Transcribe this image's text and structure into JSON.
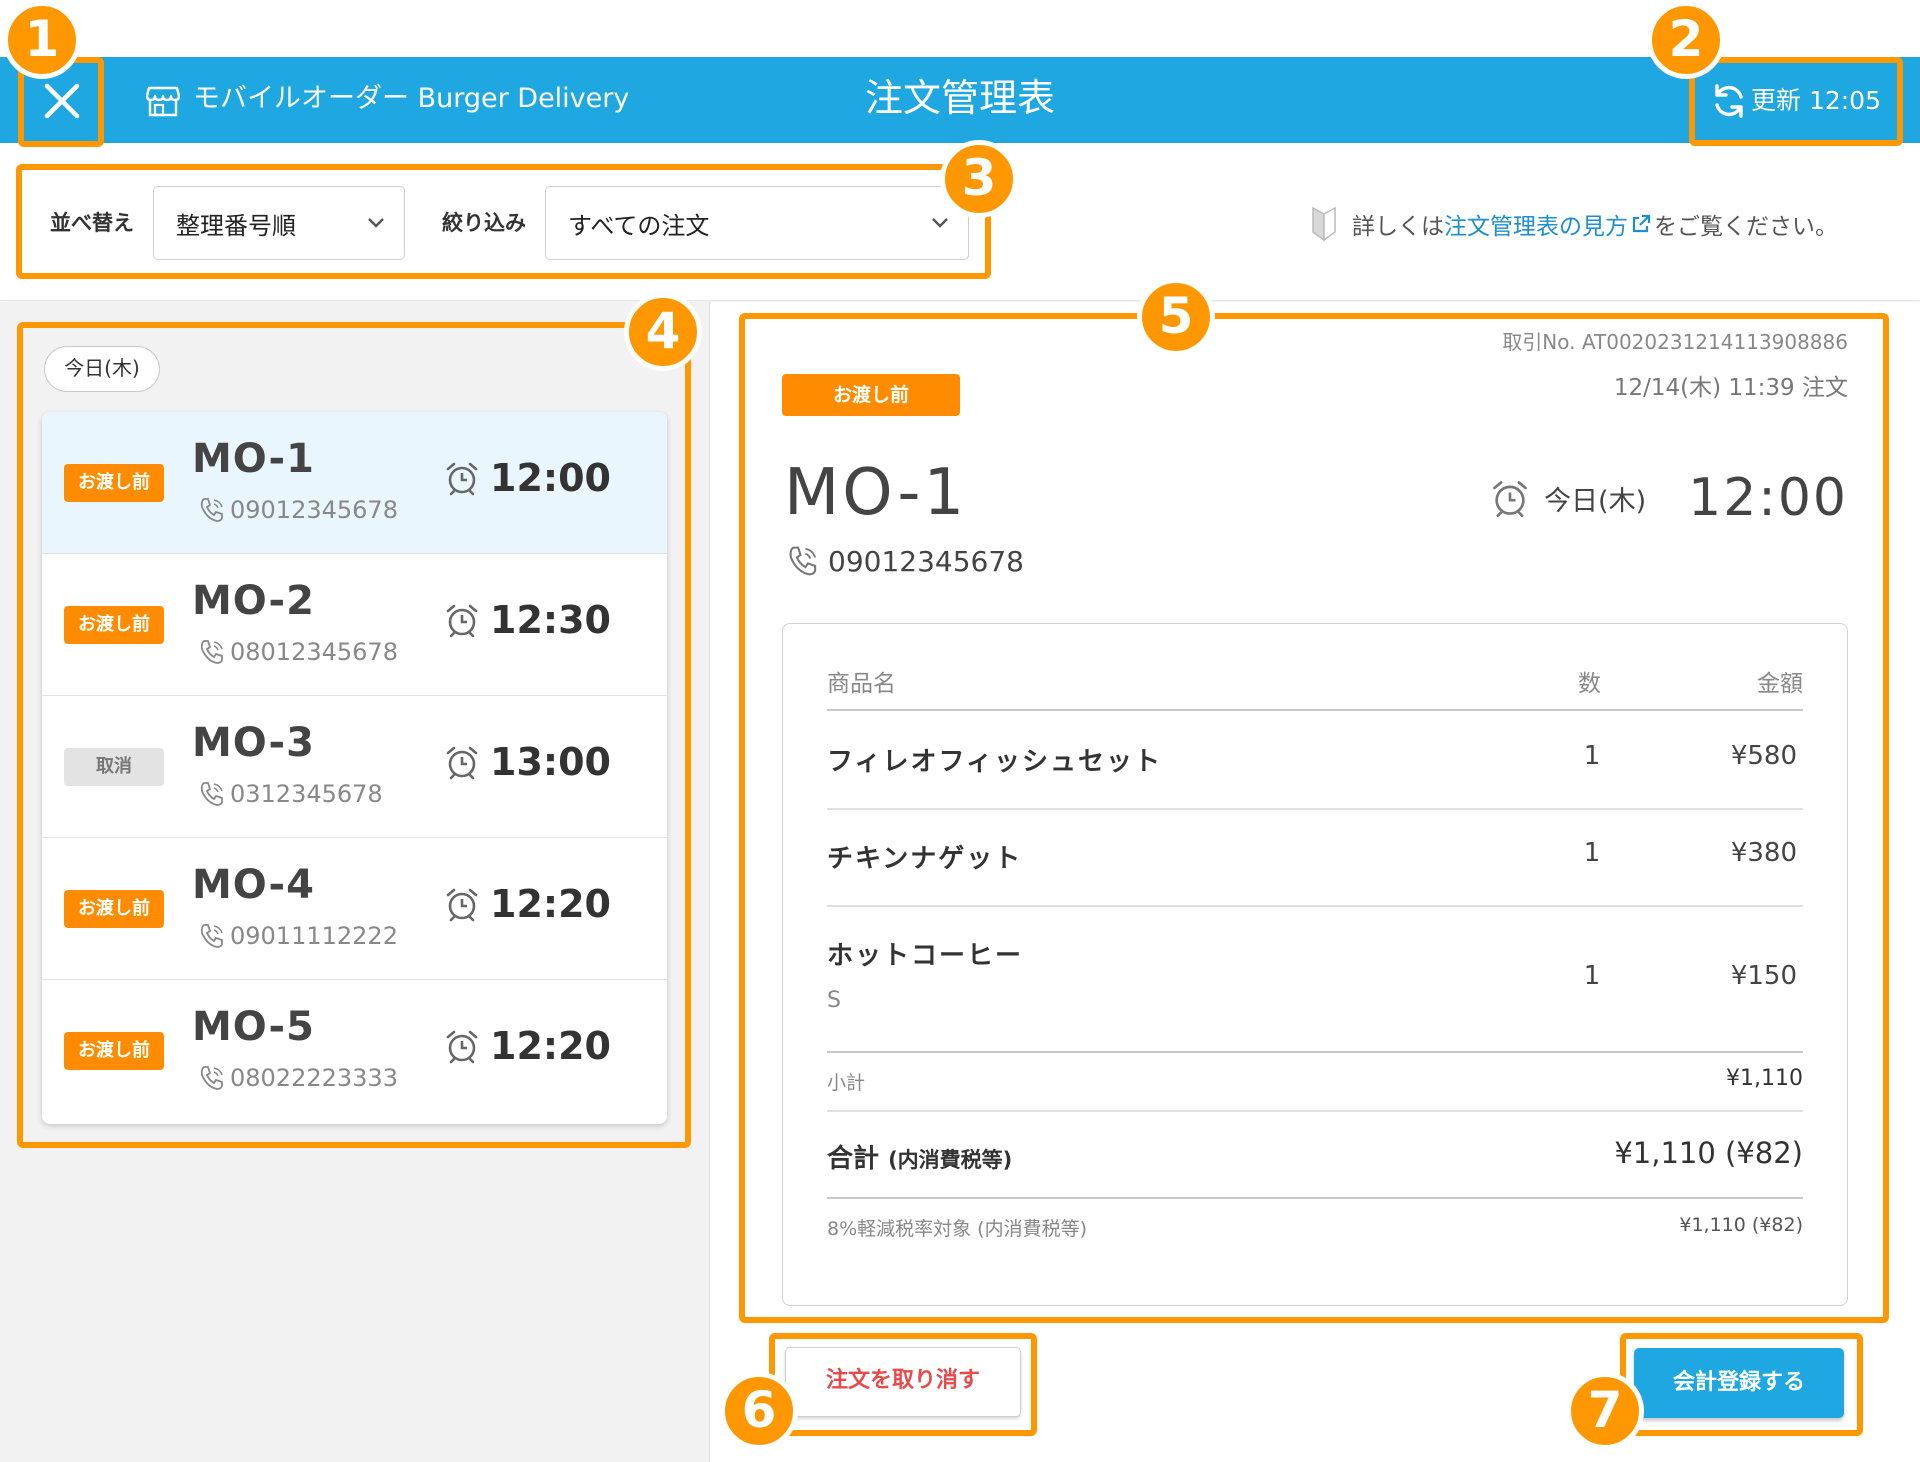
{
  "header": {
    "store_name": "モバイルオーダー Burger Delivery",
    "title": "注文管理表",
    "refresh_label": "更新 12:05",
    "bg_color": "#1ea7e0"
  },
  "toolbar": {
    "sort_label": "並べ替え",
    "sort_value": "整理番号順",
    "filter_label": "絞り込み",
    "filter_value": "すべての注文",
    "help_prefix": "詳しくは",
    "help_link": "注文管理表の見方",
    "help_suffix": "をご覧ください。"
  },
  "orders": {
    "date_chip": "今日(木)",
    "items": [
      {
        "status": "お渡し前",
        "no": "MO-1",
        "phone": "09012345678",
        "time": "12:00"
      },
      {
        "status": "お渡し前",
        "no": "MO-2",
        "phone": "08012345678",
        "time": "12:30"
      },
      {
        "status": "取消",
        "no": "MO-3",
        "phone": "0312345678",
        "time": "13:00"
      },
      {
        "status": "お渡し前",
        "no": "MO-4",
        "phone": "09011112222",
        "time": "12:20"
      },
      {
        "status": "お渡し前",
        "no": "MO-5",
        "phone": "08022223333",
        "time": "12:20"
      }
    ]
  },
  "detail": {
    "transaction_no": "取引No. AT0020231214113908886",
    "ordered_at": "12/14(木)  11:39  注文",
    "status": "お渡し前",
    "order_no": "MO-1",
    "phone": "09012345678",
    "pickup_day": "今日(木)",
    "pickup_time": "12:00",
    "table": {
      "col_name": "商品名",
      "col_qty": "数",
      "col_amount": "金額",
      "rows": [
        {
          "name": "フィレオフィッシュセット",
          "option": "",
          "qty": "1",
          "price": "¥580"
        },
        {
          "name": "チキンナゲット",
          "option": "",
          "qty": "1",
          "price": "¥380"
        },
        {
          "name": "ホットコーヒー",
          "option": "S",
          "qty": "1",
          "price": "¥150"
        }
      ]
    },
    "subtotal_label": "小計",
    "subtotal": "¥1,110",
    "total_label": "合計",
    "total_note": "(内消費税等)",
    "total": "¥1,110 (¥82)",
    "tax_label": "8%軽減税率対象 (内消費税等)",
    "tax_value": "¥1,110 (¥82)"
  },
  "actions": {
    "cancel_label": "注文を取り消す",
    "register_label": "会計登録する"
  },
  "callouts": [
    "1",
    "2",
    "3",
    "4",
    "5",
    "6",
    "7"
  ],
  "colors": {
    "accent": "#1ea7e0",
    "pending": "#ff8c00",
    "highlight": "#ff9800",
    "danger": "#e84a4a",
    "link": "#1b8fcf"
  }
}
